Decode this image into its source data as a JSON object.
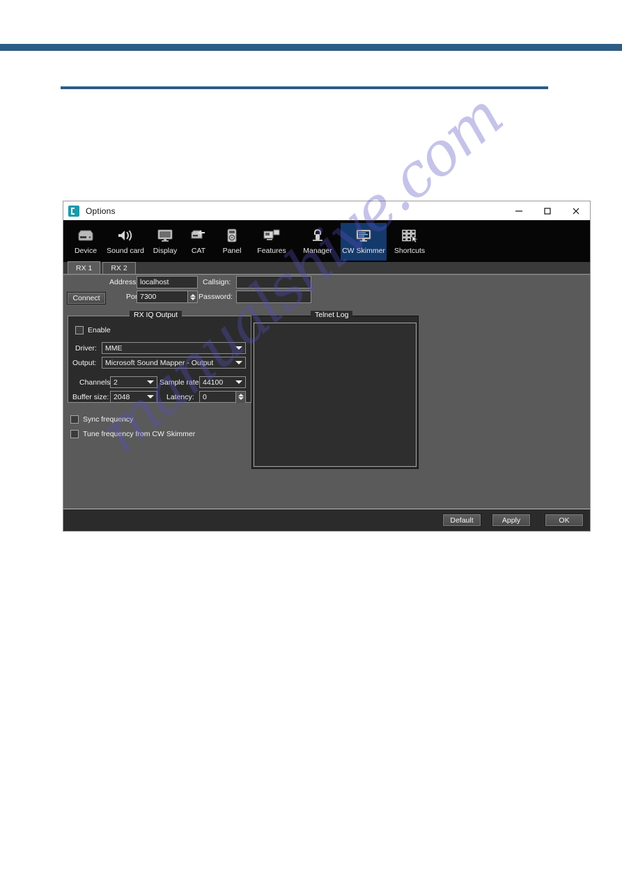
{
  "watermark": {
    "text": "manualshive.com"
  },
  "dialog": {
    "title": "Options",
    "window_controls": [
      {
        "name": "minimize",
        "label": "—"
      },
      {
        "name": "maximize",
        "label": "□"
      },
      {
        "name": "close",
        "label": "✕"
      }
    ],
    "toolbar": [
      {
        "label": "Device",
        "icon": "server-icon",
        "selected": false
      },
      {
        "label": "Sound card",
        "icon": "speaker-icon",
        "selected": false
      },
      {
        "label": "Display",
        "icon": "monitor-icon",
        "selected": false
      },
      {
        "label": "CAT",
        "icon": "cat-transfer-icon",
        "selected": false
      },
      {
        "label": "Panel",
        "icon": "panel-device-icon",
        "selected": false
      },
      {
        "label": "Features",
        "icon": "windows-icon",
        "selected": false
      },
      {
        "label": "Manager",
        "icon": "lock-icon",
        "selected": false
      },
      {
        "label": "CW Skimmer",
        "icon": "skimmer-icon",
        "selected": true
      },
      {
        "label": "Shortcuts",
        "icon": "keyboard-icon",
        "selected": false
      }
    ],
    "tabs": [
      {
        "label": "RX 1",
        "active": true
      },
      {
        "label": "RX 2",
        "active": false
      }
    ],
    "connection": {
      "connect_label": "Connect",
      "address_label": "Address:",
      "address_value": "localhost",
      "port_label": "Port:",
      "port_value": "7300",
      "callsign_label": "Callsign:",
      "callsign_value": "",
      "password_label": "Password:",
      "password_value": ""
    },
    "rx_iq_output": {
      "title": "RX IQ Output",
      "enable_label": "Enable",
      "enable_checked": false,
      "driver_label": "Driver:",
      "driver_value": "MME",
      "output_label": "Output:",
      "output_value": "Microsoft Sound Mapper - Output",
      "channels_label": "Channels:",
      "channels_value": "2",
      "sample_rate_label": "Sample rate:",
      "sample_rate_value": "44100",
      "buffer_size_label": "Buffer size:",
      "buffer_size_value": "2048",
      "latency_label": "Latency:",
      "latency_value": "0"
    },
    "options": [
      {
        "label": "Sync frequency",
        "checked": false
      },
      {
        "label": "Tune frequency from CW Skimmer",
        "checked": false
      }
    ],
    "telnet": {
      "title": "Telnet Log",
      "content": ""
    },
    "footer": {
      "default_label": "Default",
      "apply_label": "Apply",
      "ok_label": "OK"
    }
  },
  "colors": {
    "page_accent": "#2d5d85",
    "tool_selected": "#14396b",
    "dialog_bg": "#2b2b2b",
    "panel_bg": "#5a5a5a",
    "field_bg": "#2e2e2e",
    "watermark": "#5650be"
  }
}
